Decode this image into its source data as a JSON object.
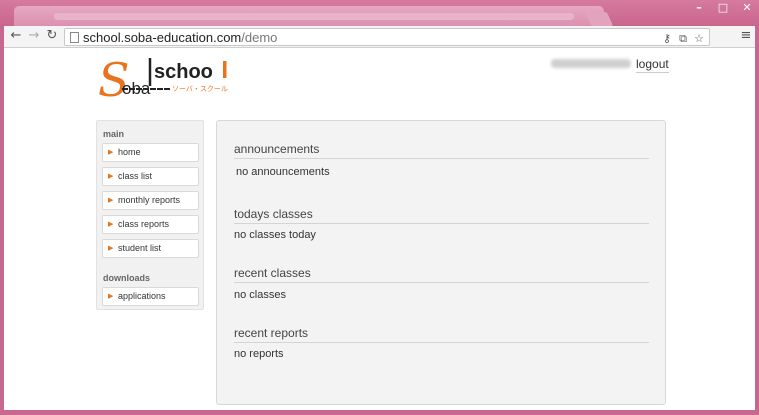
{
  "browser": {
    "url_host": "school.soba-education.com",
    "url_path": "/demo"
  },
  "header": {
    "logo_text": "school",
    "logo_brand": "Soba",
    "logo_tagline": "ソーバ・スクール",
    "logout_label": "logout"
  },
  "sidebar": {
    "main_label": "main",
    "main_items": [
      {
        "label": "home"
      },
      {
        "label": "class list"
      },
      {
        "label": "monthly reports"
      },
      {
        "label": "class reports"
      },
      {
        "label": "student list"
      }
    ],
    "downloads_label": "downloads",
    "download_items": [
      {
        "label": "applications"
      }
    ]
  },
  "main": {
    "sections": [
      {
        "title": "announcements",
        "body": "no announcements"
      },
      {
        "title": "todays classes",
        "body": "no classes today"
      },
      {
        "title": "recent classes",
        "body": "no classes"
      },
      {
        "title": "recent reports",
        "body": "no reports"
      }
    ]
  },
  "colors": {
    "window_frame": "#c8678f",
    "accent_orange": "#e8741f"
  }
}
